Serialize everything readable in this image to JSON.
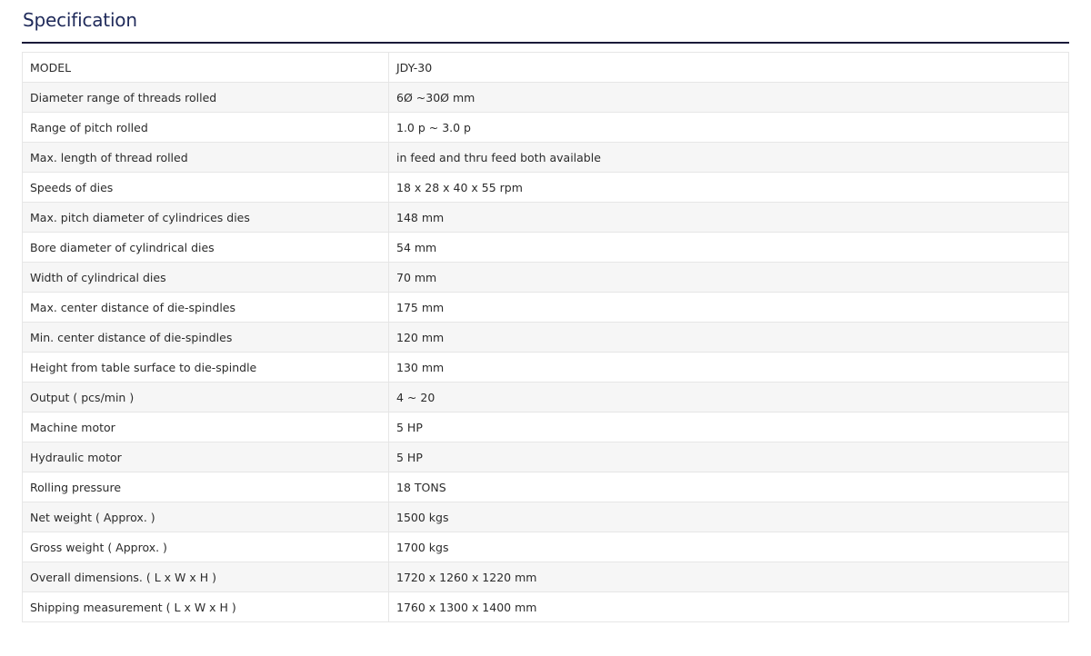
{
  "section": {
    "title": "Specification"
  },
  "spec_table": {
    "rows": [
      {
        "label": "MODEL",
        "value": "JDY-30"
      },
      {
        "label": "Diameter range of threads rolled",
        "value": "6Ø ~30Ø mm"
      },
      {
        "label": "Range of pitch rolled",
        "value": "1.0 p ~ 3.0 p"
      },
      {
        "label": "Max. length of thread rolled",
        "value": "in feed and thru feed both available"
      },
      {
        "label": "Speeds of dies",
        "value": "18 x 28 x 40 x 55 rpm"
      },
      {
        "label": "Max. pitch diameter of cylindrices dies",
        "value": "148 mm"
      },
      {
        "label": "Bore diameter of cylindrical dies",
        "value": "54 mm"
      },
      {
        "label": "Width of cylindrical dies",
        "value": "70 mm"
      },
      {
        "label": "Max. center distance of die-spindles",
        "value": "175 mm"
      },
      {
        "label": "Min. center distance of die-spindles",
        "value": "120 mm"
      },
      {
        "label": "Height from table surface to die-spindle",
        "value": "130 mm"
      },
      {
        "label": "Output ( pcs/min )",
        "value": "4 ~ 20"
      },
      {
        "label": "Machine motor",
        "value": "5 HP"
      },
      {
        "label": "Hydraulic motor",
        "value": "5 HP"
      },
      {
        "label": "Rolling pressure",
        "value": "18 TONS"
      },
      {
        "label": "Net weight ( Approx. )",
        "value": "1500 kgs"
      },
      {
        "label": "Gross weight ( Approx. )",
        "value": "1700 kgs"
      },
      {
        "label": "Overall dimensions. ( L x W x H )",
        "value": "1720 x 1260 x 1220 mm"
      },
      {
        "label": "Shipping measurement ( L x W x H )",
        "value": "1760 x 1300 x 1400 mm"
      }
    ]
  }
}
